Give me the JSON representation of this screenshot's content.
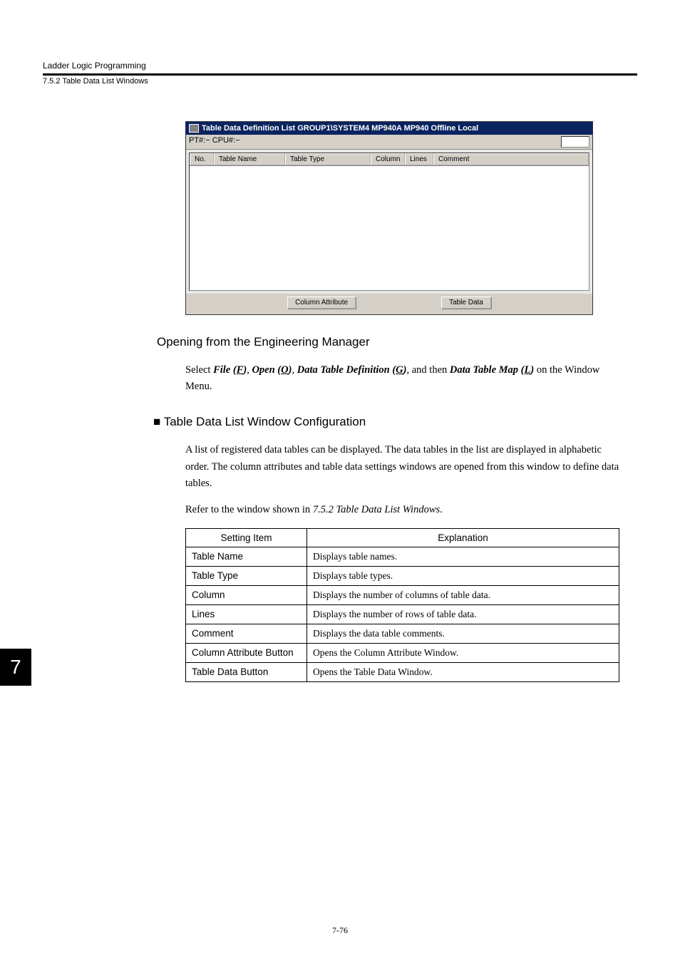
{
  "header": {
    "chapter": "Ladder Logic Programming",
    "section": "7.5.2  Table Data List Windows"
  },
  "screenshot": {
    "title": "Table Data Definition List   GROUP1\\SYSTEM4  MP940A  MP940     Offline  Local",
    "status_left": "PT#:− CPU#:−",
    "columns": {
      "no": "No.",
      "table_name": "Table Name",
      "table_type": "Table Type",
      "column": "Column",
      "lines": "Lines",
      "comment": "Comment"
    },
    "buttons": {
      "column_attribute": "Column Attribute",
      "table_data": "Table Data"
    }
  },
  "subheading1": "Opening from the Engineering Manager",
  "para1": {
    "p1": "Select ",
    "file": "File (",
    "file_u": "F",
    "file_c": ")",
    "sep1": ", ",
    "open": "Open (",
    "open_u": "O",
    "open_c": ")",
    "sep2": ", ",
    "dtd": "Data Table Definition (",
    "dtd_u": "G",
    "dtd_c": ")",
    "mid": ", and then ",
    "dtm": "Data Table Map (",
    "dtm_u": "L",
    "dtm_c": ")",
    "tail": " on the Window Menu."
  },
  "sqheading": "Table Data List Window Configuration",
  "para2": "A list of registered data tables can be displayed. The data tables in the list are displayed in alphabetic order. The column attributes and table data settings windows are opened from this window to define data tables.",
  "para3": {
    "pre": "Refer to the window shown in ",
    "ital": "7.5.2 Table Data List Windows",
    "post": "."
  },
  "config_table": {
    "h1": "Setting Item",
    "h2": "Explanation",
    "rows": [
      {
        "item": "Table Name",
        "exp": "Displays table names."
      },
      {
        "item": "Table Type",
        "exp": "Displays table types."
      },
      {
        "item": "Column",
        "exp": "Displays the number of columns of table data."
      },
      {
        "item": "Lines",
        "exp": "Displays the number of rows of table data."
      },
      {
        "item": "Comment",
        "exp": "Displays the data table comments."
      },
      {
        "item": "Column Attribute Button",
        "exp": "Opens the Column Attribute Window."
      },
      {
        "item": "Table Data Button",
        "exp": "Opens the Table Data Window."
      }
    ]
  },
  "side_tab": "7",
  "page_num": "7-76"
}
